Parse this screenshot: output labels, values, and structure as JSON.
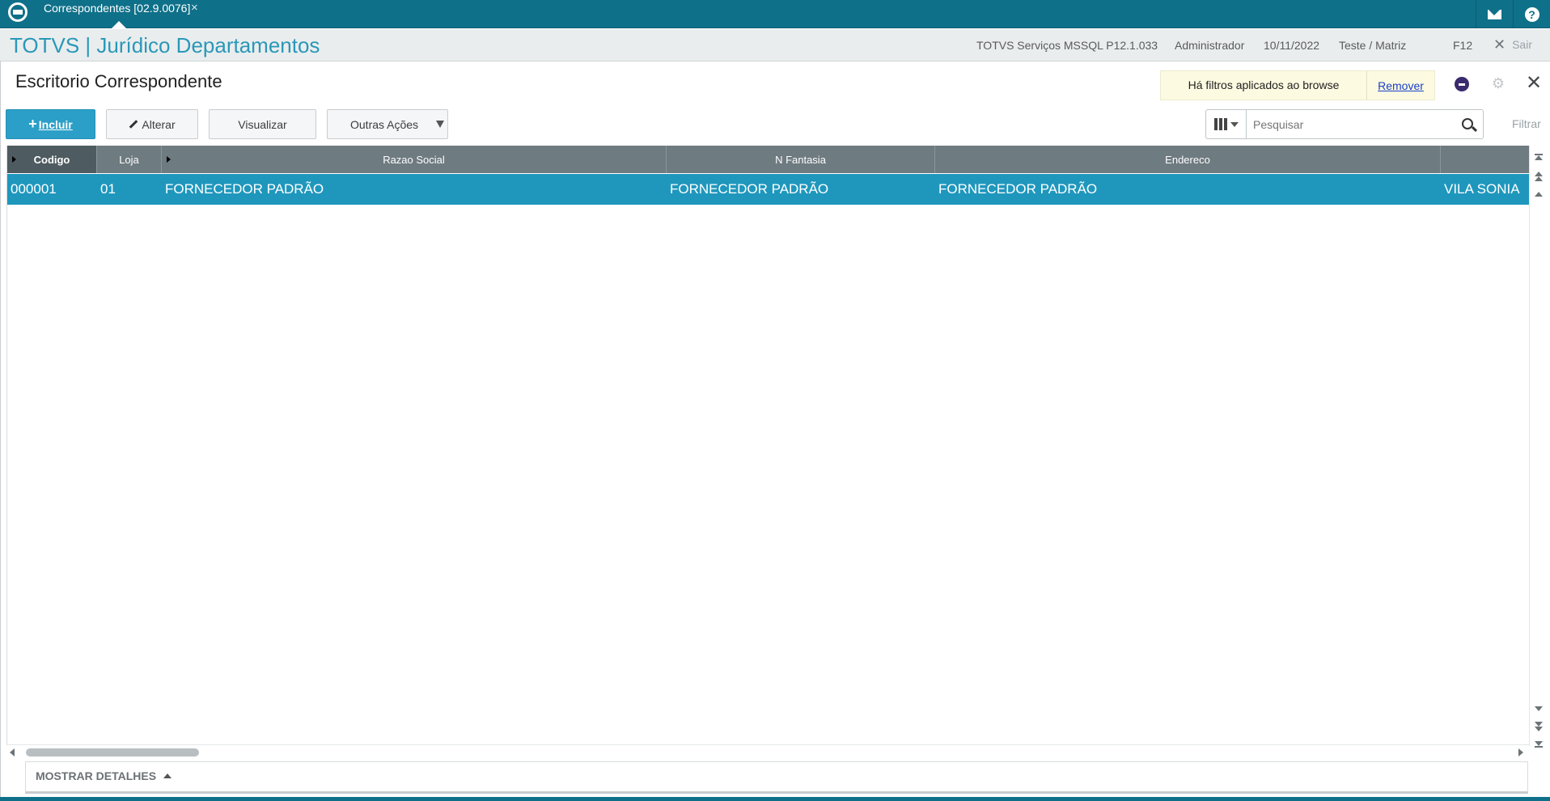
{
  "topbar": {
    "tab_label": "Correspondentes [02.9.0076]",
    "tab_close": "×"
  },
  "header": {
    "app_title": "TOTVS | Jurídico Departamentos",
    "environment": "TOTVS Serviços MSSQL P12.1.033",
    "user": "Administrador",
    "date": "10/11/2022",
    "branch": "Teste / Matriz",
    "shortcut": "F12",
    "exit_label": "Sair"
  },
  "page": {
    "title": "Escritorio Correspondente",
    "filter_notice": "Há filtros aplicados ao browse",
    "remove_filter": "Remover"
  },
  "toolbar": {
    "add_label": "Incluir",
    "edit_label": "Alterar",
    "view_label": "Visualizar",
    "more_label": "Outras Ações",
    "search_placeholder": "Pesquisar",
    "filter_label": "Filtrar"
  },
  "table": {
    "columns": [
      "Codigo",
      "Loja",
      "Razao Social",
      "N Fantasia",
      "Endereco"
    ],
    "rows": [
      [
        "000001",
        "01",
        "FORNECEDOR PADRÃO",
        "FORNECEDOR PADRÃO",
        "FORNECEDOR PADRÃO",
        "VILA SONIA"
      ]
    ]
  },
  "footer": {
    "details_label": "MOSTRAR DETALHES"
  },
  "colors": {
    "topbar": "#0f7089",
    "accent": "#2a98b8",
    "selected_row": "#1f97bd",
    "header_grid": "#6e7b80",
    "filter_notice_bg": "#fcfae0"
  },
  "icons": [
    "totvs-logo-icon",
    "mail-icon",
    "help-icon",
    "close-icon",
    "gear-icon",
    "smiley-icon",
    "search-icon",
    "columns-icon"
  ]
}
